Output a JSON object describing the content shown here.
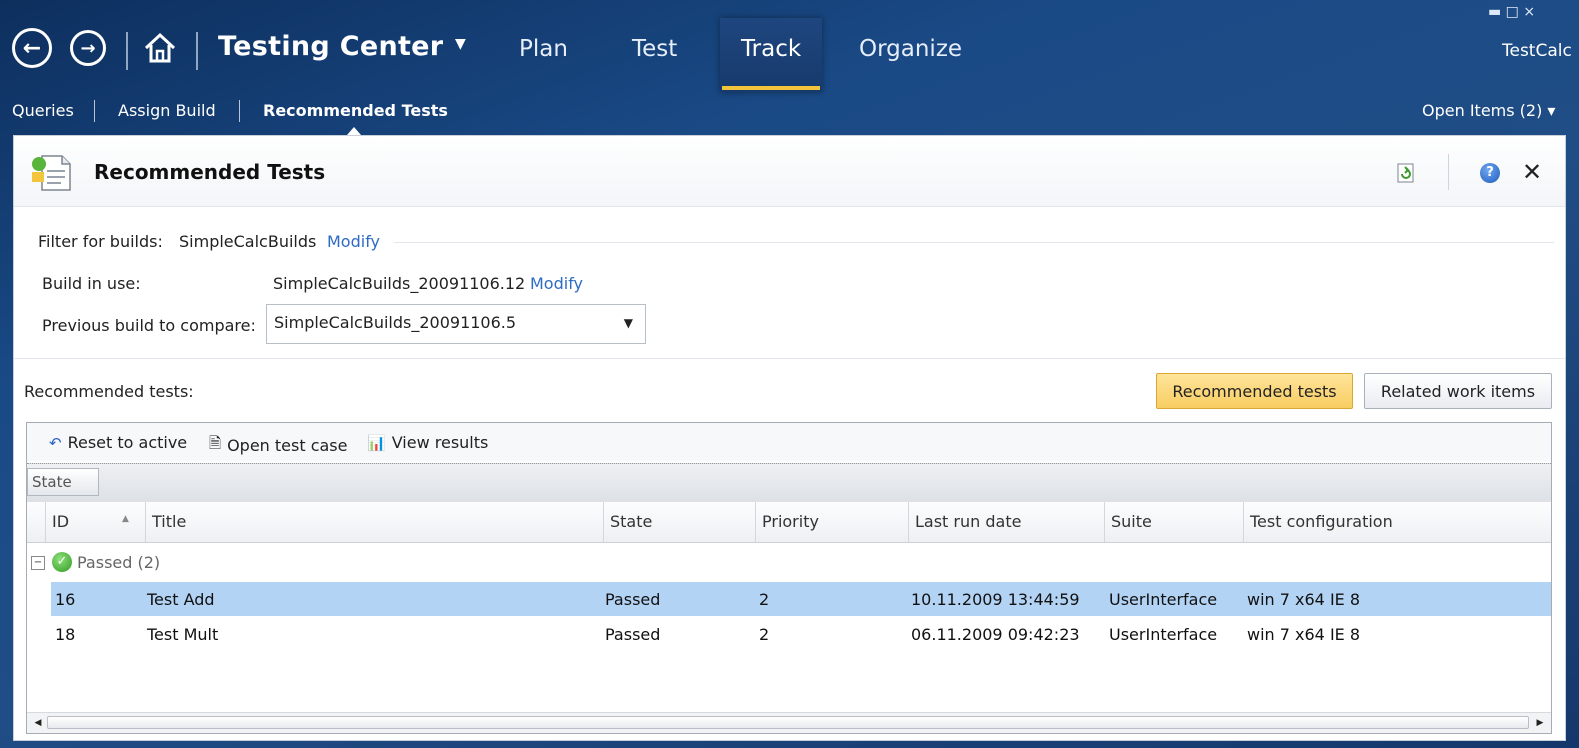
{
  "nav": {
    "back_icon": "arrow-left-icon",
    "forward_icon": "arrow-right-icon",
    "home_icon": "home-icon"
  },
  "app": {
    "title": "Testing Center",
    "user": "TestCalc"
  },
  "tabs": [
    {
      "label": "Plan"
    },
    {
      "label": "Test"
    },
    {
      "label": "Track"
    },
    {
      "label": "Organize"
    }
  ],
  "subnav": {
    "items": [
      "Queries",
      "Assign Build",
      "Recommended Tests"
    ],
    "open_items": "Open Items (2)"
  },
  "panel": {
    "title": "Recommended Tests",
    "filter_label": "Filter for builds:",
    "filter_value": "SimpleCalcBuilds",
    "modify": "Modify",
    "build_label": "Build in use:",
    "build_value": "SimpleCalcBuilds_20091106.12",
    "compare_label": "Previous build to compare:",
    "compare_value": "SimpleCalcBuilds_20091106.5",
    "section_label": "Recommended tests:",
    "btn_recommended": "Recommended tests",
    "btn_related": "Related work items"
  },
  "toolbar": {
    "reset": "Reset to active",
    "open": "Open test case",
    "view": "View results"
  },
  "group_by": "State",
  "columns": [
    "ID",
    "Title",
    "State",
    "Priority",
    "Last run date",
    "Suite",
    "Test configuration"
  ],
  "group": {
    "label": "Passed (2)"
  },
  "rows": [
    {
      "id": "16",
      "title": "Test Add",
      "state": "Passed",
      "priority": "2",
      "date": "10.11.2009 13:44:59",
      "suite": "UserInterface",
      "config": "win 7 x64 IE 8"
    },
    {
      "id": "18",
      "title": "Test Mult",
      "state": "Passed",
      "priority": "2",
      "date": "06.11.2009 09:42:23",
      "suite": "UserInterface",
      "config": "win 7 x64 IE 8"
    }
  ],
  "colors": {
    "accent": "#f2c43a",
    "selection": "#b3d3f4",
    "link": "#2e6bc4"
  }
}
